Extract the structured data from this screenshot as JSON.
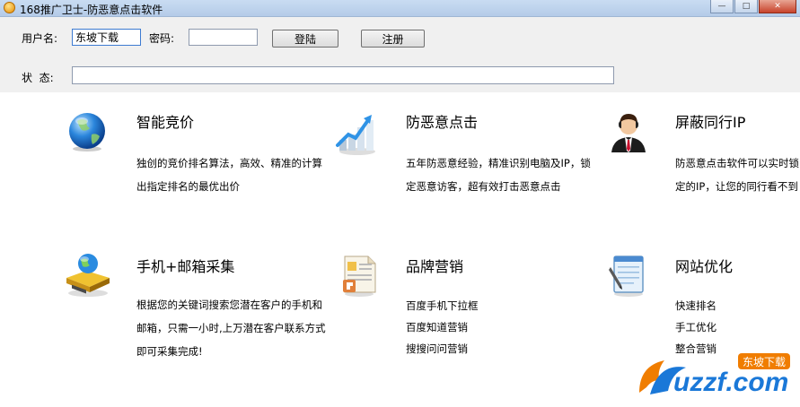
{
  "window": {
    "title": "168推广卫士-防恶意点击软件",
    "min_glyph": "—",
    "max_glyph": "□",
    "close_glyph": "✕"
  },
  "login": {
    "username_label": "用户名:",
    "username_value": "东坡下载",
    "password_label": "密码:",
    "password_value": "",
    "login_button": "登陆",
    "register_button": "注册",
    "status_label": "状  态:",
    "status_value": ""
  },
  "features": [
    {
      "title": "智能竞价",
      "icon": "globe-icon",
      "desc": "独创的竞价排名算法，高效、精准的计算出指定排名的最优出价"
    },
    {
      "title": "防恶意点击",
      "icon": "growth-chart-icon",
      "desc": "五年防恶意经验，精准识别电脑及IP，锁定恶意访客，超有效打击恶意点击"
    },
    {
      "title": "屏蔽同行IP",
      "icon": "businessman-icon",
      "desc": "防恶意点击软件可以实时锁定的IP，让您的同行看不到您"
    },
    {
      "title": "手机+邮箱采集",
      "icon": "network-folder-icon",
      "desc": "根据您的关键词搜索您潜在客户的手机和邮箱，只需一小时,上万潜在客户联系方式即可采集完成!"
    },
    {
      "title": "品牌营销",
      "icon": "document-icon",
      "lines": [
        "百度手机下拉框",
        "百度知道营销",
        "搜搜问问营销"
      ]
    },
    {
      "title": "网站优化",
      "icon": "notepad-icon",
      "lines": [
        "快速排名",
        "手工优化",
        "整合营销"
      ]
    }
  ],
  "watermark": {
    "brand": "uzzf.com",
    "badge": "东坡下载",
    "colors": {
      "blue": "#1a78d8",
      "orange": "#f07d00"
    }
  }
}
